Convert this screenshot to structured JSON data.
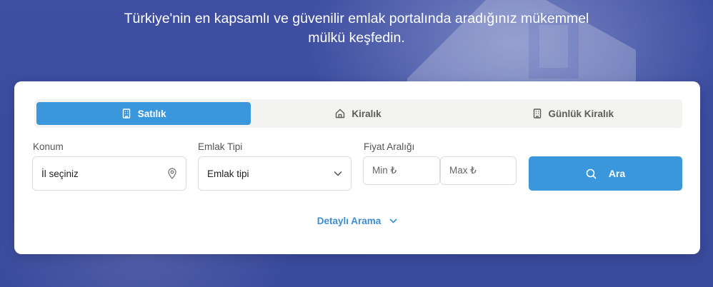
{
  "hero": {
    "line1": "Türkiye'nin en kapsamlı ve güvenilir emlak portalında aradığınız mükemmel",
    "line2": "mülkü keşfedin."
  },
  "tabs": [
    {
      "label": "Satılık",
      "icon": "building-icon",
      "active": true
    },
    {
      "label": "Kiralık",
      "icon": "home-icon",
      "active": false
    },
    {
      "label": "Günlük Kiralık",
      "icon": "building-icon",
      "active": false
    }
  ],
  "location": {
    "label": "Konum",
    "value": "İl seçiniz",
    "icon": "map-pin-icon"
  },
  "property_type": {
    "label": "Emlak Tipi",
    "value": "Emlak tipi",
    "icon": "chevron-down-icon"
  },
  "price": {
    "label": "Fiyat Aralığı",
    "min_placeholder": "Min ₺",
    "max_placeholder": "Max ₺"
  },
  "search": {
    "label": "Ara",
    "icon": "search-icon"
  },
  "detailed_search": {
    "label": "Detaylı Arama",
    "icon": "chevron-down-icon"
  },
  "colors": {
    "accent": "#3b97db",
    "hero_bg": "#3d4fa0",
    "tab_bg": "#f3f3f1"
  }
}
